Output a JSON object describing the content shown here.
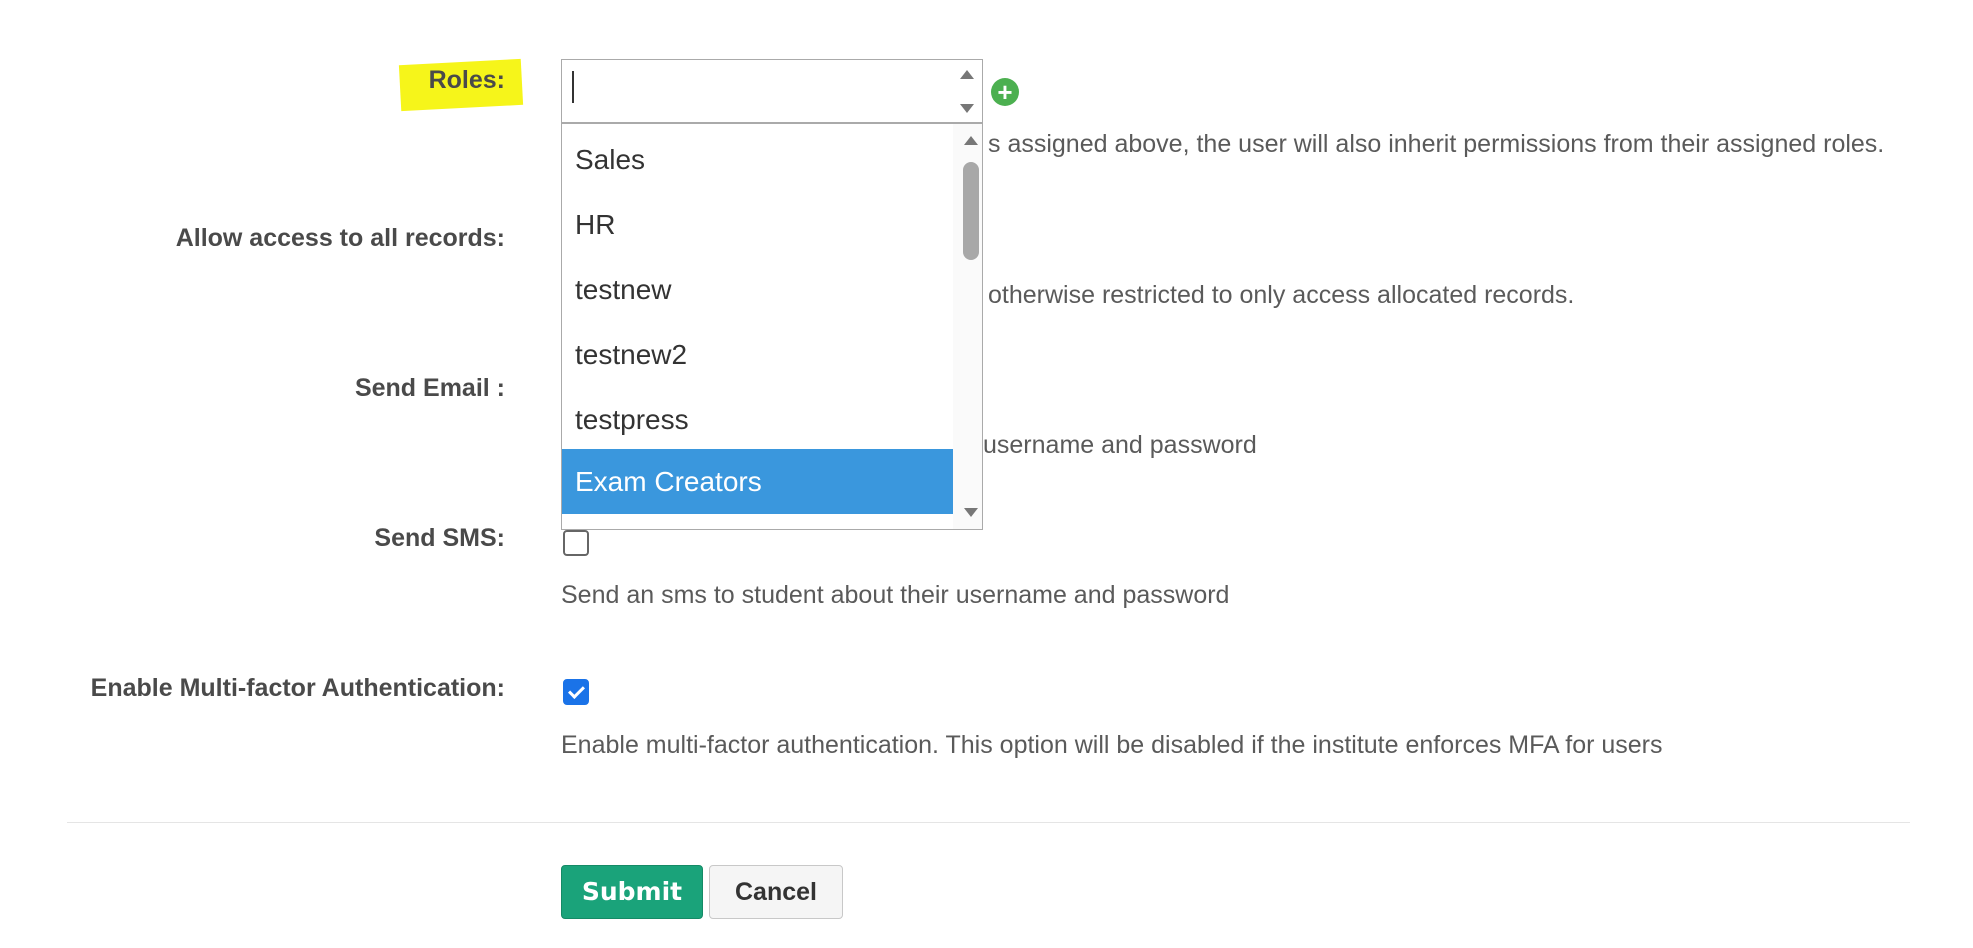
{
  "fields": {
    "roles": {
      "label": "Roles:",
      "help": "s assigned above, the user will also inherit permissions from their assigned roles.",
      "input_value": "",
      "add_icon": "plus-circle-icon",
      "options": [
        "Sales",
        "HR",
        "testnew",
        "testnew2",
        "testpress",
        "Exam Creators"
      ],
      "highlighted_option": "Exam Creators"
    },
    "allow_all_records": {
      "label": "Allow access to all records:",
      "help": "otherwise restricted to only access allocated records."
    },
    "send_email": {
      "label": "Send Email :",
      "help": "username and password"
    },
    "send_sms": {
      "label": "Send SMS:",
      "checked": false,
      "help": "Send an sms to student about their username and password"
    },
    "mfa": {
      "label": "Enable Multi-factor Authentication:",
      "checked": true,
      "help": "Enable multi-factor authentication. This option will be disabled if the institute enforces MFA for users"
    }
  },
  "actions": {
    "submit_label": "Submit",
    "cancel_label": "Cancel"
  },
  "colors": {
    "highlight": "#f6f51a",
    "selected_option": "#3a97dd",
    "submit": "#1aa37a",
    "add_icon": "#4cb050",
    "checkbox_checked": "#1a73e8"
  }
}
